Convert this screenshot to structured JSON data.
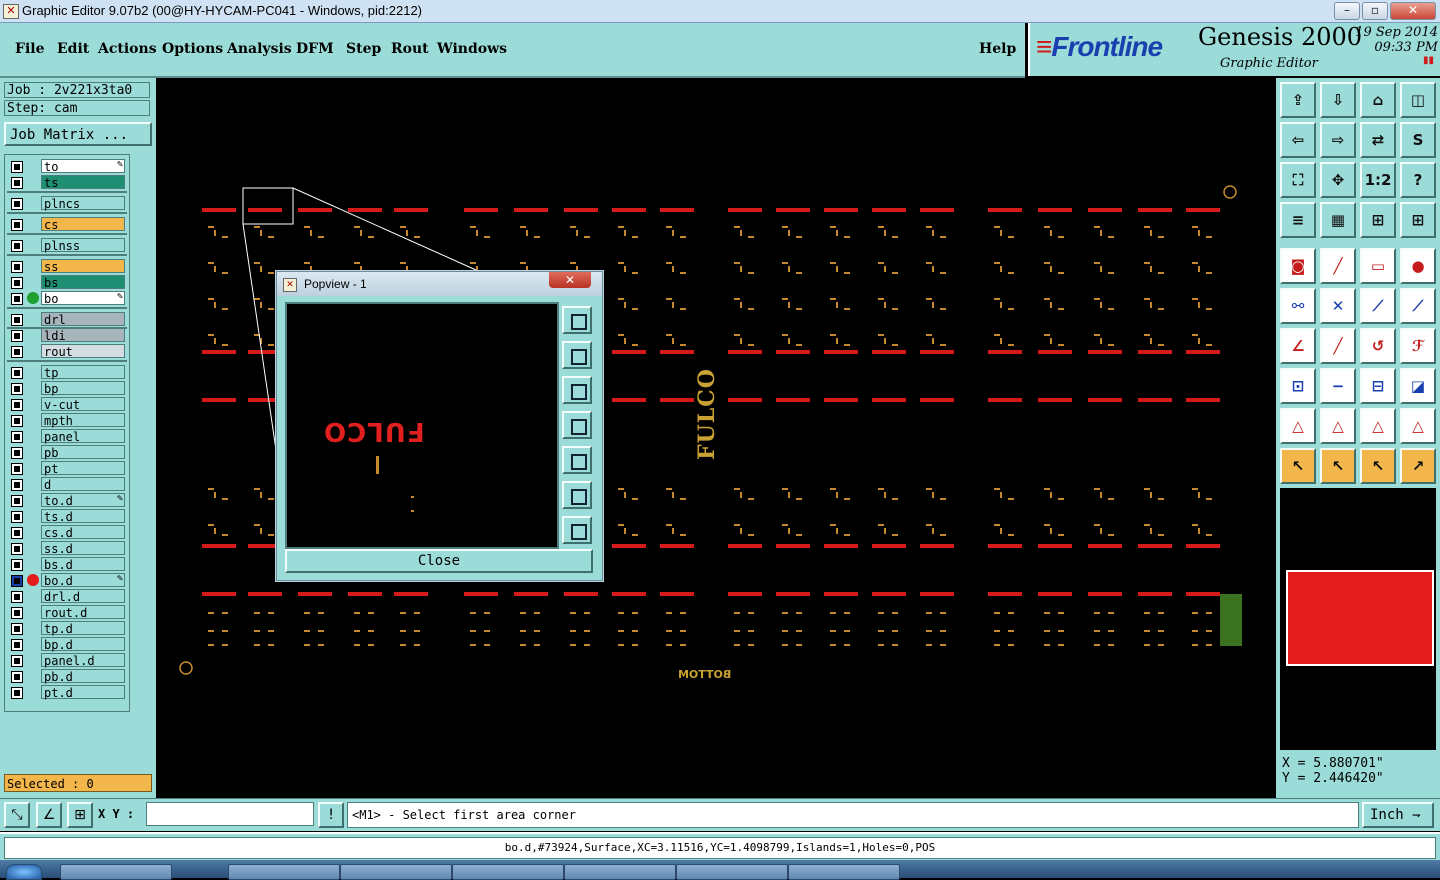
{
  "window": {
    "title": "Graphic Editor 9.07b2 (00@HY-HYCAM-PC041 - Windows, pid:2212)"
  },
  "menu": {
    "items": [
      "File",
      "Edit",
      "Actions",
      "Options",
      "Analysis",
      "DFM",
      "Step",
      "Rout",
      "Windows"
    ],
    "help": "Help"
  },
  "brand": {
    "logo": "Frontline",
    "product": "Genesis 2000",
    "module": "Graphic Editor",
    "date": "19  Sep  2014",
    "time": "09:33  PM"
  },
  "job": {
    "name": "Job : 2v221x3ta0",
    "step": "Step: cam",
    "matrix_button": "Job Matrix ..."
  },
  "layers": [
    {
      "name": "to",
      "color": "#ffffff",
      "edit": true
    },
    {
      "name": "ts",
      "color": "#1f8f74"
    },
    {
      "name": "plncs",
      "color": "#9bdcd9"
    },
    {
      "name": "cs",
      "color": "#f2b64a"
    },
    {
      "name": "plnss",
      "color": "#9bdcd9"
    },
    {
      "name": "ss",
      "color": "#f2b64a"
    },
    {
      "name": "bs",
      "color": "#1f8f74"
    },
    {
      "name": "bo",
      "color": "#ffffff",
      "edit": true,
      "active": true
    },
    {
      "name": "drl",
      "color": "#a8b4bc"
    },
    {
      "name": "ldi",
      "color": "#a8b4bc"
    },
    {
      "name": "rout",
      "color": "#d4dde2"
    },
    {
      "name": "tp",
      "color": "#9bdcd9"
    },
    {
      "name": "bp",
      "color": "#9bdcd9"
    },
    {
      "name": "v-cut",
      "color": "#9bdcd9"
    },
    {
      "name": "mpth",
      "color": "#9bdcd9"
    },
    {
      "name": "panel",
      "color": "#9bdcd9"
    },
    {
      "name": "pb",
      "color": "#9bdcd9"
    },
    {
      "name": "pt",
      "color": "#9bdcd9"
    },
    {
      "name": "d",
      "color": "#9bdcd9"
    },
    {
      "name": "to.d",
      "color": "#9bdcd9",
      "edit": true
    },
    {
      "name": "ts.d",
      "color": "#9bdcd9"
    },
    {
      "name": "cs.d",
      "color": "#9bdcd9"
    },
    {
      "name": "ss.d",
      "color": "#9bdcd9"
    },
    {
      "name": "bs.d",
      "color": "#9bdcd9"
    },
    {
      "name": "bo.d",
      "color": "#9bdcd9",
      "edit": true,
      "work": true
    },
    {
      "name": "drl.d",
      "color": "#9bdcd9"
    },
    {
      "name": "rout.d",
      "color": "#9bdcd9"
    },
    {
      "name": "tp.d",
      "color": "#9bdcd9"
    },
    {
      "name": "bp.d",
      "color": "#9bdcd9"
    },
    {
      "name": "panel.d",
      "color": "#9bdcd9"
    },
    {
      "name": "pb.d",
      "color": "#9bdcd9"
    },
    {
      "name": "pt.d",
      "color": "#9bdcd9"
    }
  ],
  "selected": "Selected : 0",
  "canvas": {
    "vertical_text": "FULCO",
    "bottom_text": "BOTTOM"
  },
  "popview": {
    "title": "Popview - 1",
    "preview_text": "FULCO",
    "close": "Close",
    "buttons": [
      "zoom-home-icon",
      "pan-up-icon",
      "pan-down-icon",
      "pan-left-icon",
      "pan-right-icon",
      "zoom-out-icon",
      "zoom-in-icon"
    ]
  },
  "tools": [
    [
      "arrow-up-icon",
      "arrow-down-icon",
      "home-icon",
      "split-icon"
    ],
    [
      "arrow-left-icon",
      "arrow-right-icon",
      "snap-icon",
      "s-curve-icon"
    ],
    [
      "fit-icon",
      "center-icon",
      "1:2",
      "?"
    ],
    [
      "ruler-icon",
      "grid-icon",
      "layers-a-icon",
      "layers-b-icon"
    ],
    [
      "pad-icon",
      "line-icon",
      "measure-icon",
      "dot-icon"
    ],
    [
      "connect-icon",
      "cross-icon",
      "node-a-icon",
      "node-b-icon"
    ],
    [
      "angle-icon",
      "edge-icon",
      "arc-icon",
      "ff-icon"
    ],
    [
      "snap-point-icon",
      "minus-icon",
      "box-icon",
      "shapes-icon"
    ],
    [
      "tri-a-icon",
      "tri-b-icon",
      "tri-c-icon",
      "tri-d-icon"
    ],
    [
      "pointer-icon",
      "select-icon",
      "select-drag-icon",
      "route-icon"
    ]
  ],
  "tool_labels": {
    "half": "1:2",
    "help": "?"
  },
  "coords": {
    "x": "X = 5.880701\"",
    "y": "Y = 2.446420\""
  },
  "cmd": {
    "xy_label": "X Y :",
    "input_value": "",
    "prompt": "<M1> - Select first area corner",
    "units": "Inch",
    "bang": "!"
  },
  "status": "bo.d,#73924,Surface,XC=3.11516,YC=1.4098799,Islands=1,Holes=0,POS"
}
